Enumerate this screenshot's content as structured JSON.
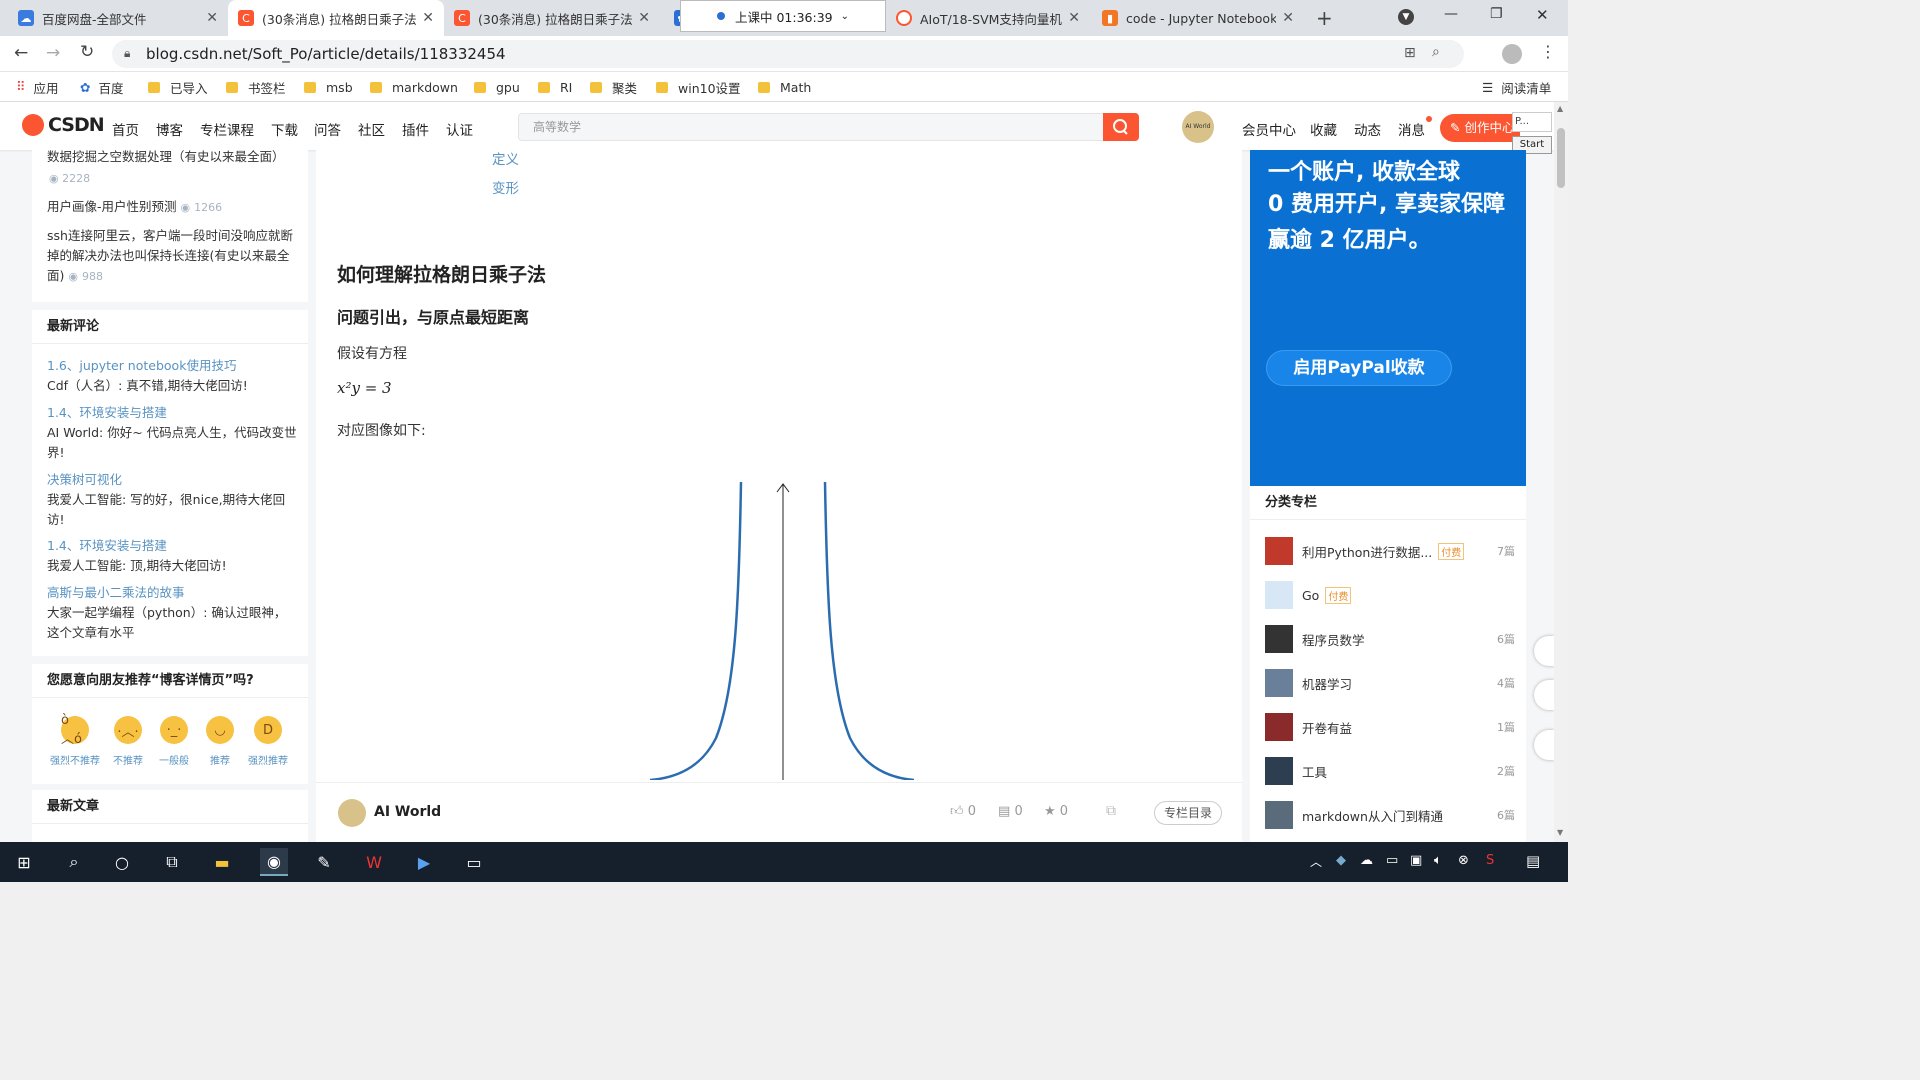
{
  "tabs": [
    {
      "title": "百度网盘-全部文件",
      "active": false
    },
    {
      "title": "(30条消息) 拉格朗日乘子法",
      "active": true
    },
    {
      "title": "(30条消息) 拉格朗日乘子法",
      "active": false
    },
    {
      "title": "AIoT/18-SVM支持向量机",
      "active": false
    },
    {
      "title": "code - Jupyter Notebook",
      "active": false
    }
  ],
  "timer": "上课中 01:36:39",
  "address": "blog.csdn.net/Soft_Po/article/details/118332454",
  "bookmarks": [
    "应用",
    "百度",
    "已导入",
    "书签栏",
    "msb",
    "markdown",
    "gpu",
    "RI",
    "聚类",
    "win10设置",
    "Math"
  ],
  "reading_list": "阅读清单",
  "csdn": {
    "logo": "CSDN",
    "nav": [
      "首页",
      "博客",
      "专栏课程",
      "下载",
      "问答",
      "社区",
      "插件",
      "认证"
    ],
    "search_placeholder": "高等数学",
    "right_nav": [
      "会员中心",
      "收藏",
      "动态",
      "消息"
    ],
    "create_btn": "创作中心",
    "avatar_text": "AI World",
    "start": "Start"
  },
  "left": {
    "hot": [
      {
        "title": "数据挖掘之空数据处理（有史以来最全面）",
        "views": "2228"
      },
      {
        "title": "用户画像-用户性别预测",
        "views": "1266"
      },
      {
        "title": "ssh连接阿里云，客户端一段时间没响应就断掉的解决办法也叫保持长连接(有史以来最全面)",
        "views": "988"
      }
    ],
    "comments_title": "最新评论",
    "comments": [
      {
        "article": "1.6、jupyter notebook使用技巧",
        "text": "Cdf（人名）: 真不错,期待大佬回访!"
      },
      {
        "article": "1.4、环境安装与搭建",
        "text": "AI World: 你好~ 代码点亮人生，代码改变世界!"
      },
      {
        "article": "决策树可视化",
        "text": "我爱人工智能: 写的好，很nice,期待大佬回访!"
      },
      {
        "article": "1.4、环境安装与搭建",
        "text": "我爱人工智能: 顶,期待大佬回访!"
      },
      {
        "article": "高斯与最小二乘法的故事",
        "text": "大家一起学编程（python）: 确认过眼神，这个文章有水平"
      }
    ],
    "recommend_title": "您愿意向朋友推荐“博客详情页”吗?",
    "ratings": [
      "强烈不推荐",
      "不推荐",
      "一般般",
      "推荐",
      "强烈推荐"
    ],
    "latest_title": "最新文章"
  },
  "article": {
    "toc": [
      "定义",
      "变形"
    ],
    "h1": "如何理解拉格朗日乘子法",
    "h2": "问题引出，与原点最短距离",
    "p1": "假设有方程",
    "eq": "x²y = 3",
    "p2": "对应图像如下:",
    "author": "AI World",
    "likes": "0",
    "comments": "0",
    "stars": "0",
    "catalog_btn": "专栏目录"
  },
  "ad": {
    "line1": "一个账户, 收款全球",
    "line2": "0 费用开户, 享卖家保障",
    "line3": "赢逾 2 亿用户。",
    "button": "启用PayPal收款"
  },
  "categories": {
    "title": "分类专栏",
    "items": [
      {
        "name": "利用Python进行数据...",
        "paid": true,
        "count": "7篇",
        "color": "#c0392b"
      },
      {
        "name": "Go",
        "paid": true,
        "count": "",
        "color": "#4a90c2"
      },
      {
        "name": "程序员数学",
        "paid": false,
        "count": "6篇",
        "color": "#333333"
      },
      {
        "name": "机器学习",
        "paid": false,
        "count": "4篇",
        "color": "#6a7f9a"
      },
      {
        "name": "开卷有益",
        "paid": false,
        "count": "1篇",
        "color": "#8a2a2a"
      },
      {
        "name": "工具",
        "paid": false,
        "count": "2篇",
        "color": "#2c3e50"
      },
      {
        "name": "markdown从入门到精通",
        "paid": false,
        "count": "6篇",
        "color": "#5a6b7c"
      }
    ],
    "paid_label": "付费"
  },
  "colors": {
    "csdn_red": "#fc5531",
    "link": "#5893c2",
    "ad_blue": "#0a71d3",
    "curve": "#2b6cb0"
  }
}
